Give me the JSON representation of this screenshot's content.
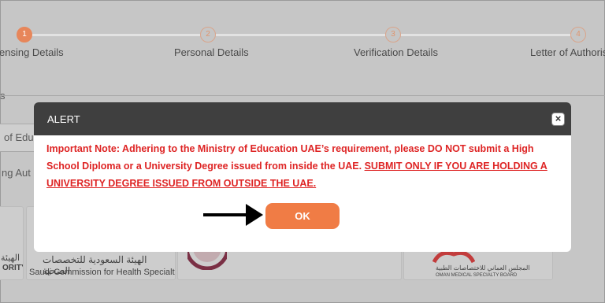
{
  "stepper": {
    "steps": [
      {
        "num": "1",
        "label": "ensing Details"
      },
      {
        "num": "2",
        "label": "Personal Details"
      },
      {
        "num": "3",
        "label": "Verification Details"
      },
      {
        "num": "4",
        "label": "Letter of Authoris"
      }
    ]
  },
  "background": {
    "fragment_s": "s",
    "input_fragment": "of Edu",
    "text_fragment": "ng Aut",
    "logos": {
      "left_ar": "الهيئة",
      "left_en": "ORITY",
      "saudi_ar": "الهيئة السعودية للتخصصات الصحية",
      "saudi_en": "Saudi Commission for Health Specialties",
      "oman_ar": "المجلس العماني للاختصاصات الطبية",
      "oman_en": "OMAN MEDICAL SPECIALTY BOARD"
    }
  },
  "alert": {
    "title": "ALERT",
    "close_glyph": "×",
    "message_plain": "Important Note: Adhering to the Ministry of Education UAE’s requirement, please DO NOT submit a High School Diploma or a University Degree issued from inside the UAE. ",
    "message_underlined": "SUBMIT ONLY IF YOU ARE HOLDING A UNIVERSITY DEGREE ISSUED FROM OUTSIDE THE UAE.",
    "ok_label": "OK"
  },
  "colors": {
    "overlay": "#c6c6c6",
    "header": "#3f3f3f",
    "message": "#de2424",
    "ok_button": "#f07c45",
    "step_active": "#e7865a"
  }
}
